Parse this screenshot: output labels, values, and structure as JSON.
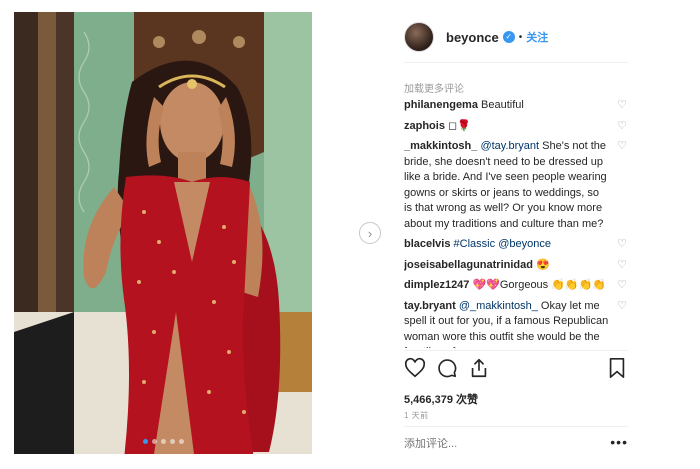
{
  "post": {
    "carousel": {
      "count": 5,
      "active": 0
    }
  },
  "header": {
    "username": "beyonce",
    "separator": "•",
    "follow_label": "关注"
  },
  "load_more_label": "加载更多评论",
  "comments": [
    {
      "user": "philanengema",
      "parts": [
        {
          "text": " Beautiful"
        }
      ]
    },
    {
      "user": "zaphois",
      "parts": [
        {
          "text": " ◻🌹"
        }
      ]
    },
    {
      "user": "_makkintosh_",
      "parts": [
        {
          "text": " "
        },
        {
          "text": "@tay.bryant",
          "mention": true
        },
        {
          "text": " She's not the bride, she doesn't need to be dressed up like a bride. And I've seen people wearing gowns or skirts or jeans to weddings, so is that wrong as well? Or you know more about my traditions and culture than me?"
        }
      ]
    },
    {
      "user": "blacelvis",
      "parts": [
        {
          "text": " "
        },
        {
          "text": "#Classic",
          "mention": true
        },
        {
          "text": " "
        },
        {
          "text": "@beyonce",
          "mention": true
        }
      ]
    },
    {
      "user": "joseisabellagunatrinidad",
      "parts": [
        {
          "text": " 😍"
        }
      ]
    },
    {
      "user": "dimplez1247",
      "parts": [
        {
          "text": " 💖💖Gorgeous 👏👏👏👏"
        }
      ]
    },
    {
      "user": "tay.bryant",
      "parts": [
        {
          "text": " "
        },
        {
          "text": "@_makkintosh_",
          "mention": true
        },
        {
          "text": "  Okay let me spell it out for you, if a famous Republican woman wore this outfit she would be the frontline of every news"
        }
      ]
    }
  ],
  "likes": "5,466,379 次赞",
  "time": "1 天前",
  "add_comment_placeholder": "添加评论...",
  "more_label": "•••",
  "colors": {
    "link": "#3897f0",
    "mention": "#003569",
    "muted": "#999999",
    "dress": "#b3121e"
  }
}
